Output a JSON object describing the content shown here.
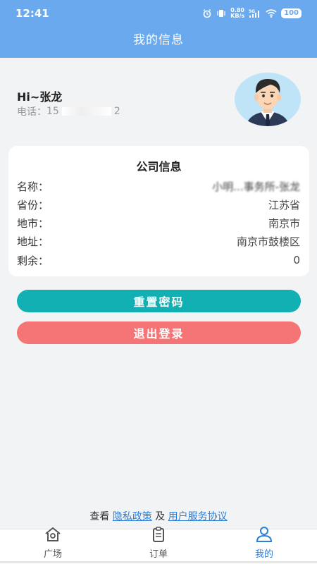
{
  "status_bar": {
    "time": "12:41",
    "speed_value": "0.80",
    "speed_unit": "KB/s",
    "network": "5G",
    "battery": "100"
  },
  "header": {
    "title": "我的信息"
  },
  "profile": {
    "greeting": "Hi~张龙",
    "phone_label": "电话：",
    "phone_prefix": "15",
    "phone_suffix": "2"
  },
  "company": {
    "title": "公司信息",
    "rows": [
      {
        "label": "名称：",
        "value": "小明...事务所-张龙"
      },
      {
        "label": "省份：",
        "value": "江苏省"
      },
      {
        "label": "地市：",
        "value": "南京市"
      },
      {
        "label": "地址：",
        "value": "南京市鼓楼区"
      },
      {
        "label": "剩余：",
        "value": "0"
      }
    ]
  },
  "buttons": {
    "reset_password": "重置密码",
    "logout": "退出登录"
  },
  "legal": {
    "prefix": "查看",
    "privacy": "隐私政策",
    "and": "及",
    "terms": "用户服务协议"
  },
  "tabs": [
    {
      "label": "广场",
      "icon": "home-icon",
      "active": false
    },
    {
      "label": "订单",
      "icon": "clipboard-icon",
      "active": false
    },
    {
      "label": "我的",
      "icon": "user-icon",
      "active": true
    }
  ],
  "colors": {
    "header": "#6aa9ee",
    "reset_button": "#12b0b2",
    "logout_button": "#f57577",
    "active_tab": "#2b7fd8"
  }
}
